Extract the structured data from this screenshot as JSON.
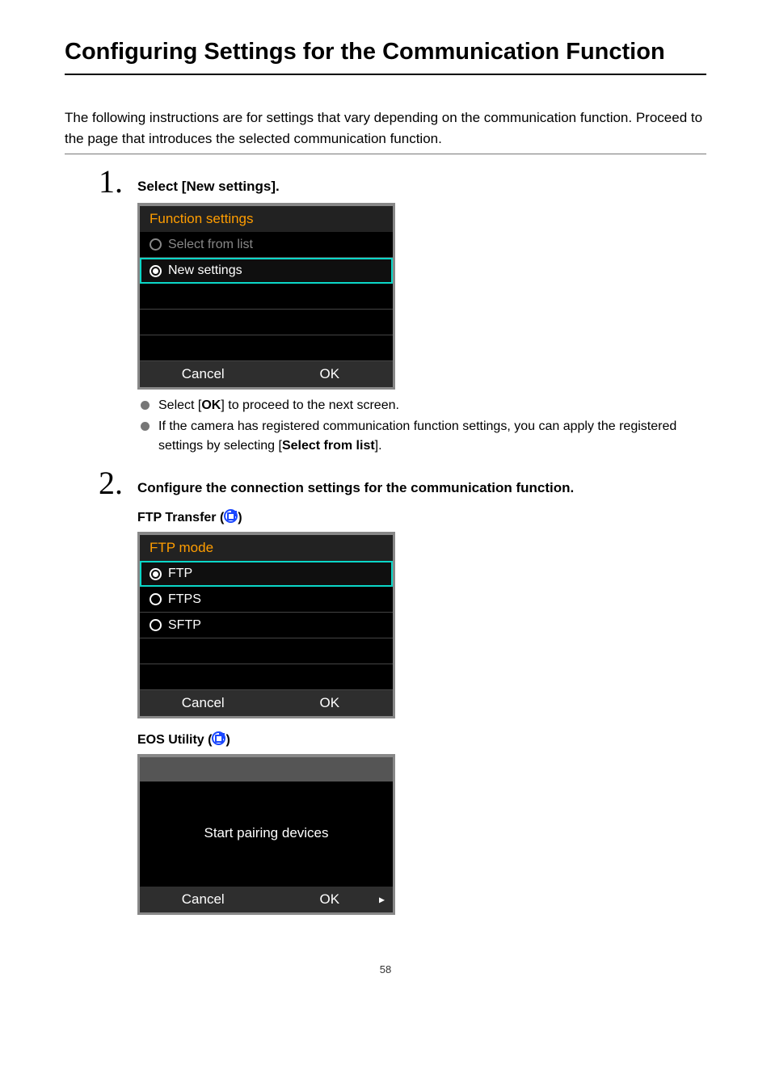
{
  "page": {
    "title": "Configuring Settings for the Communication Function",
    "intro": "The following instructions are for settings that vary depending on the communication function. Proceed to the page that introduces the selected communication function.",
    "pageNumber": "58"
  },
  "steps": {
    "s1": {
      "number": "1",
      "title_pre": "Select [",
      "title_bold": "New settings",
      "title_post": "].",
      "bullet1_pre": "Select [",
      "bullet1_bold": "OK",
      "bullet1_post": "] to proceed to the next screen.",
      "bullet2_pre": "If the camera has registered communication function settings, you can apply the registered settings by selecting [",
      "bullet2_bold": "Select from list",
      "bullet2_post": "]."
    },
    "s2": {
      "number": "2",
      "title": "Configure the connection settings for the communication function.",
      "heading1_pre": "FTP Transfer (",
      "heading1_post": ")",
      "heading2_pre": "EOS Utility (",
      "heading2_post": ")"
    }
  },
  "shot1": {
    "header": "Function settings",
    "item1": "Select from list",
    "item2": "New settings",
    "btn_cancel": "Cancel",
    "btn_ok": "OK"
  },
  "shot2": {
    "header": "FTP mode",
    "item1": "FTP",
    "item2": "FTPS",
    "item3": "SFTP",
    "btn_cancel": "Cancel",
    "btn_ok": "OK"
  },
  "shot3": {
    "message": "Start pairing devices",
    "btn_cancel": "Cancel",
    "btn_ok": "OK"
  }
}
